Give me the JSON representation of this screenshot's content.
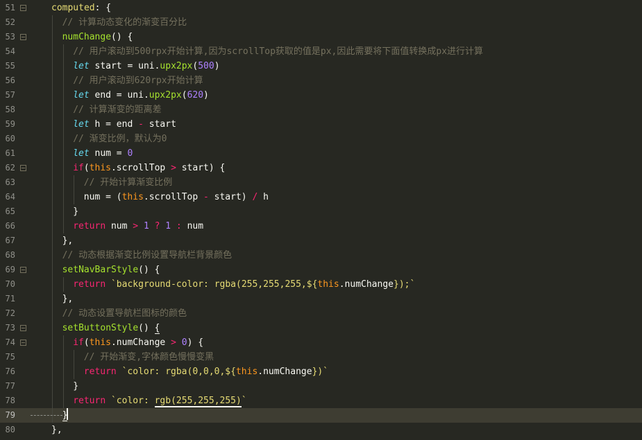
{
  "editor": {
    "lines": [
      {
        "n": "51",
        "fold": true,
        "segs": [
          [
            "p",
            "computed"
          ],
          [
            "d",
            ": {"
          ]
        ]
      },
      {
        "n": "52",
        "fold": false,
        "segs": [
          [
            "c",
            "// 计算动态变化的渐变百分比"
          ]
        ]
      },
      {
        "n": "53",
        "fold": true,
        "segs": [
          [
            "f",
            "numChange"
          ],
          [
            "d",
            "() {"
          ]
        ]
      },
      {
        "n": "54",
        "fold": false,
        "segs": [
          [
            "c",
            "// 用户滚动到500rpx开始计算,因为scrollTop获取的值是px,因此需要将下面值转换成px进行计算"
          ]
        ]
      },
      {
        "n": "55",
        "fold": false,
        "segs": [
          [
            "k",
            "let"
          ],
          [
            "d",
            " start = uni."
          ],
          [
            "f",
            "upx2px"
          ],
          [
            "d",
            "("
          ],
          [
            "n",
            "500"
          ],
          [
            "d",
            ")"
          ]
        ]
      },
      {
        "n": "56",
        "fold": false,
        "segs": [
          [
            "c",
            "// 用户滚动到620rpx开始计算"
          ]
        ]
      },
      {
        "n": "57",
        "fold": false,
        "segs": [
          [
            "k",
            "let"
          ],
          [
            "d",
            " end = uni."
          ],
          [
            "f",
            "upx2px"
          ],
          [
            "d",
            "("
          ],
          [
            "n",
            "620"
          ],
          [
            "d",
            ")"
          ]
        ]
      },
      {
        "n": "58",
        "fold": false,
        "segs": [
          [
            "c",
            "// 计算渐变的距离差"
          ]
        ]
      },
      {
        "n": "59",
        "fold": false,
        "segs": [
          [
            "k",
            "let"
          ],
          [
            "d",
            " h = end "
          ],
          [
            "o",
            "-"
          ],
          [
            "d",
            " start"
          ]
        ]
      },
      {
        "n": "60",
        "fold": false,
        "segs": [
          [
            "c",
            "// 渐变比例，默认为0"
          ]
        ]
      },
      {
        "n": "61",
        "fold": false,
        "segs": [
          [
            "k",
            "let"
          ],
          [
            "d",
            " num = "
          ],
          [
            "n",
            "0"
          ]
        ]
      },
      {
        "n": "62",
        "fold": true,
        "segs": [
          [
            "kw",
            "if"
          ],
          [
            "d",
            "("
          ],
          [
            "t",
            "this"
          ],
          [
            "d",
            ".scrollTop "
          ],
          [
            "o",
            ">"
          ],
          [
            "d",
            " start) {"
          ]
        ]
      },
      {
        "n": "63",
        "fold": false,
        "segs": [
          [
            "c",
            "// 开始计算渐变比例"
          ]
        ]
      },
      {
        "n": "64",
        "fold": false,
        "segs": [
          [
            "d",
            "num = ("
          ],
          [
            "t",
            "this"
          ],
          [
            "d",
            ".scrollTop "
          ],
          [
            "o",
            "-"
          ],
          [
            "d",
            " start) "
          ],
          [
            "o",
            "/"
          ],
          [
            "d",
            " h"
          ]
        ]
      },
      {
        "n": "65",
        "fold": false,
        "segs": [
          [
            "d",
            "}"
          ]
        ]
      },
      {
        "n": "66",
        "fold": false,
        "segs": [
          [
            "kw",
            "return"
          ],
          [
            "d",
            " num "
          ],
          [
            "o",
            ">"
          ],
          [
            "d",
            " "
          ],
          [
            "n",
            "1"
          ],
          [
            "d",
            " "
          ],
          [
            "o",
            "?"
          ],
          [
            "d",
            " "
          ],
          [
            "n",
            "1"
          ],
          [
            "d",
            " "
          ],
          [
            "o",
            ":"
          ],
          [
            "d",
            " num"
          ]
        ]
      },
      {
        "n": "67",
        "fold": false,
        "segs": [
          [
            "d",
            "},"
          ]
        ]
      },
      {
        "n": "68",
        "fold": false,
        "segs": [
          [
            "c",
            "// 动态根据渐变比例设置导航栏背景颜色"
          ]
        ]
      },
      {
        "n": "69",
        "fold": true,
        "segs": [
          [
            "f",
            "setNavBarStyle"
          ],
          [
            "d",
            "() {"
          ]
        ]
      },
      {
        "n": "70",
        "fold": false,
        "segs": [
          [
            "kw",
            "return"
          ],
          [
            "d",
            " "
          ],
          [
            "s",
            "`background-color: rgba(255,255,255,${"
          ],
          [
            "t",
            "this"
          ],
          [
            "d",
            ".numChange"
          ],
          [
            "s",
            "});`"
          ]
        ]
      },
      {
        "n": "71",
        "fold": false,
        "segs": [
          [
            "d",
            "},"
          ]
        ]
      },
      {
        "n": "72",
        "fold": false,
        "segs": [
          [
            "c",
            "// 动态设置导航栏图标的颜色"
          ]
        ]
      },
      {
        "n": "73",
        "fold": true,
        "segs": [
          [
            "f",
            "setButtonStyle"
          ],
          [
            "d",
            "() "
          ],
          [
            "m",
            "{"
          ]
        ]
      },
      {
        "n": "74",
        "fold": true,
        "segs": [
          [
            "kw",
            "if"
          ],
          [
            "d",
            "("
          ],
          [
            "t",
            "this"
          ],
          [
            "d",
            ".numChange "
          ],
          [
            "o",
            ">"
          ],
          [
            "d",
            " "
          ],
          [
            "n",
            "0"
          ],
          [
            "d",
            ") {"
          ]
        ]
      },
      {
        "n": "75",
        "fold": false,
        "segs": [
          [
            "c",
            "// 开始渐变,字体颜色慢慢变黑"
          ]
        ]
      },
      {
        "n": "76",
        "fold": false,
        "segs": [
          [
            "kw",
            "return"
          ],
          [
            "d",
            " "
          ],
          [
            "s",
            "`color: rgba(0,0,0,${"
          ],
          [
            "t",
            "this"
          ],
          [
            "d",
            ".numChange"
          ],
          [
            "s",
            "})`"
          ]
        ]
      },
      {
        "n": "77",
        "fold": false,
        "segs": [
          [
            "d",
            "}"
          ]
        ]
      },
      {
        "n": "78",
        "fold": false,
        "segs": [
          [
            "kw",
            "return"
          ],
          [
            "d",
            " "
          ],
          [
            "s",
            "`color: "
          ],
          [
            "u",
            "rgb(255,255,255)"
          ],
          [
            "s",
            "`"
          ]
        ]
      },
      {
        "n": "79",
        "fold": false,
        "segs": [
          [
            "m",
            "}"
          ]
        ]
      },
      {
        "n": "80",
        "fold": false,
        "segs": [
          [
            "d",
            "},"
          ]
        ]
      }
    ]
  },
  "colors": {
    "background": "#272822",
    "active_line": "#3e3d32",
    "comment": "#75715e",
    "keyword": "#f92672",
    "storage": "#66d9ef",
    "function": "#a6e22e",
    "number": "#ae81ff",
    "string": "#e6db74",
    "this": "#fd971f"
  }
}
